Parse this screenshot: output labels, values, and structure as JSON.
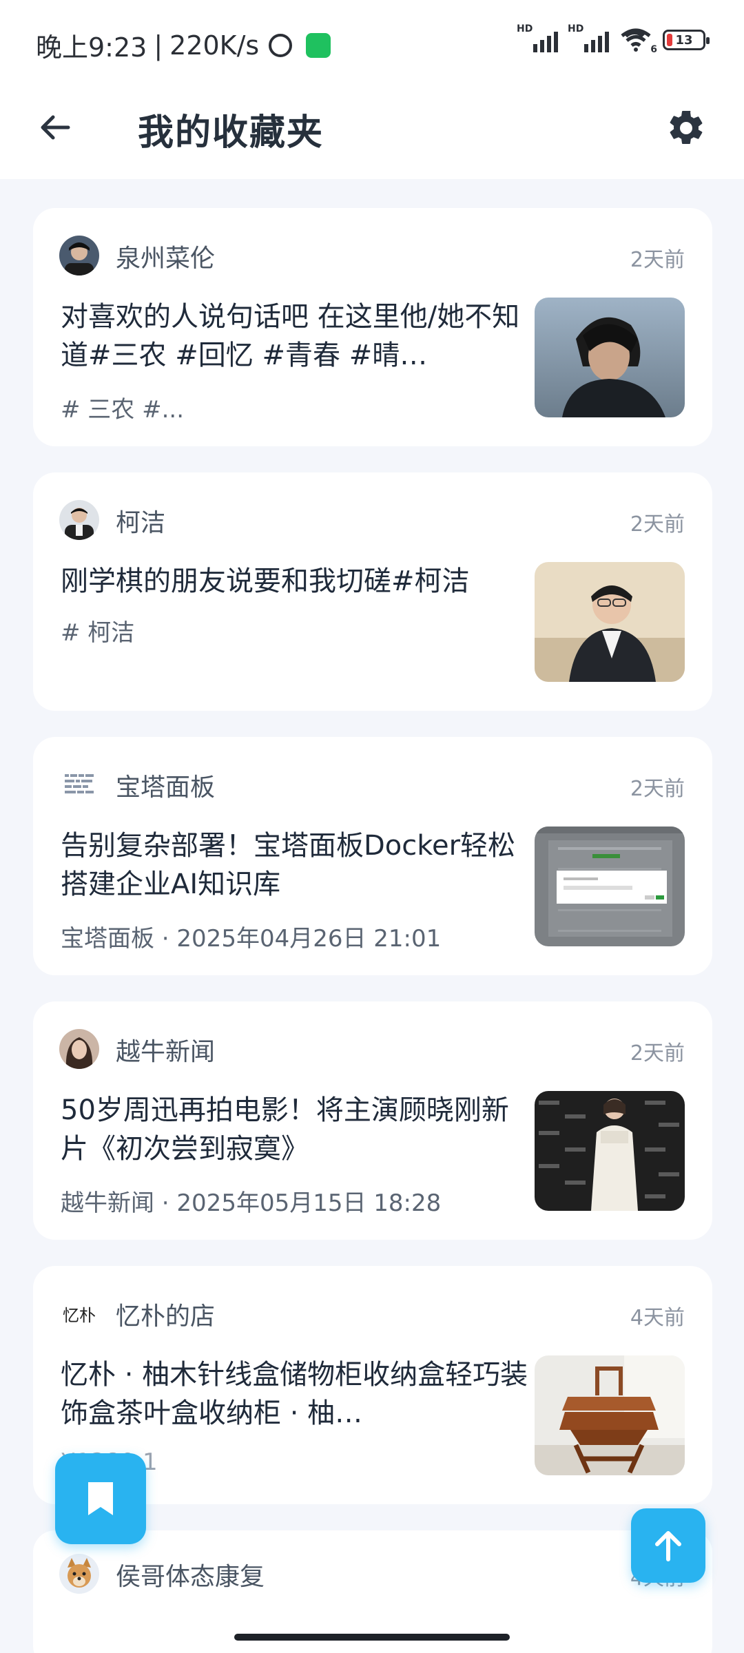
{
  "status": {
    "time": "晚上9:23",
    "speed": "220K/s",
    "battery": "13",
    "hd1": "HD",
    "hd2": "HD",
    "wifi_num": "6"
  },
  "appbar": {
    "title": "我的收藏夹",
    "back_icon": "arrow-left-icon",
    "settings_icon": "gear-icon"
  },
  "items": [
    {
      "author": "泉州菜伦",
      "time": "2天前",
      "title": "对喜欢的人说句话吧 在这里他/她不知道#三农 #回忆 #青春 #晴…",
      "meta": "# 三农 #..."
    },
    {
      "author": "柯洁",
      "time": "2天前",
      "title": "刚学棋的朋友说要和我切磋#柯洁",
      "meta": "# 柯洁"
    },
    {
      "author": "宝塔面板",
      "time": "2天前",
      "title": "告别复杂部署！宝塔面板Docker轻松搭建企业AI知识库",
      "meta": "宝塔面板 · 2025年04月26日 21:01"
    },
    {
      "author": "越牛新闻",
      "time": "2天前",
      "title": "50岁周迅再拍电影！将主演顾晓刚新片《初次尝到寂寞》",
      "meta": "越牛新闻 · 2025年05月15日 18:28"
    },
    {
      "author": "忆朴的店",
      "avatar_text": "忆朴",
      "time": "4天前",
      "title": "忆朴 · 柚木针线盒储物柜收纳盒轻巧装饰盒茶叶盒收纳柜 · 柚…",
      "meta": "¥1280.1"
    },
    {
      "author": "侯哥体态康复",
      "time": "4天前"
    }
  ],
  "colors": {
    "accent": "#29b3f0",
    "background": "#f4f6fb",
    "card": "#ffffff"
  }
}
